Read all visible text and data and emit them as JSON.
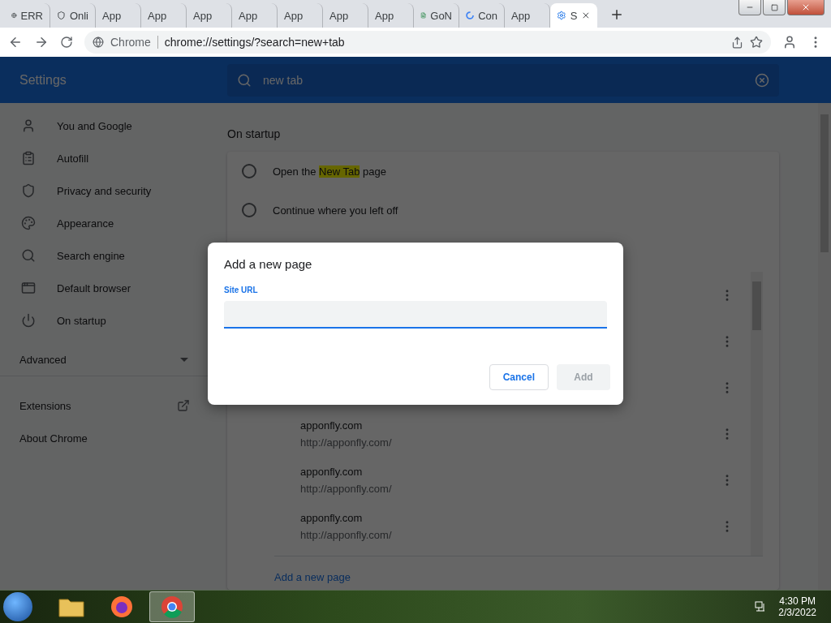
{
  "tabs": [
    {
      "label": "ERR",
      "kind": "globe",
      "selected": false
    },
    {
      "label": "Onli",
      "kind": "badge",
      "selected": false
    },
    {
      "label": "App",
      "kind": "plain",
      "selected": false
    },
    {
      "label": "App",
      "kind": "plain",
      "selected": false
    },
    {
      "label": "App",
      "kind": "plain",
      "selected": false
    },
    {
      "label": "App",
      "kind": "plain",
      "selected": false
    },
    {
      "label": "App",
      "kind": "plain",
      "selected": false
    },
    {
      "label": "App",
      "kind": "plain",
      "selected": false
    },
    {
      "label": "App",
      "kind": "plain",
      "selected": false
    },
    {
      "label": "GoN",
      "kind": "doc",
      "selected": false
    },
    {
      "label": "Con",
      "kind": "google",
      "selected": false
    },
    {
      "label": "App",
      "kind": "plain",
      "selected": false
    },
    {
      "label": "S",
      "kind": "gear",
      "selected": true
    }
  ],
  "address_bar": {
    "site_label": "Chrome",
    "url": "chrome://settings/?search=new+tab"
  },
  "settings_header": {
    "title": "Settings",
    "search": {
      "value": "new tab"
    }
  },
  "sidebar": {
    "items": [
      {
        "label": "You and Google",
        "kind": "person"
      },
      {
        "label": "Autofill",
        "kind": "clipboard"
      },
      {
        "label": "Privacy and security",
        "kind": "shield"
      },
      {
        "label": "Appearance",
        "kind": "palette"
      },
      {
        "label": "Search engine",
        "kind": "search"
      },
      {
        "label": "Default browser",
        "kind": "browser"
      },
      {
        "label": "On startup",
        "kind": "power"
      }
    ],
    "advanced": {
      "label": "Advanced",
      "expanded": false
    },
    "links": [
      {
        "label": "Extensions",
        "external": true
      },
      {
        "label": "About Chrome",
        "external": false
      }
    ]
  },
  "on_startup": {
    "heading": "On startup",
    "options": [
      {
        "before": "Open the ",
        "highlight": "New Tab",
        "after": " page",
        "selected": false
      },
      {
        "before": "Continue where you left off",
        "selected": false
      }
    ],
    "pages": [
      {
        "kind": "covered"
      },
      {
        "kind": "covered"
      },
      {
        "kind": "covered"
      },
      {
        "kind": "page",
        "name": "apponfly.com",
        "url": "http://apponfly.com/"
      },
      {
        "kind": "page",
        "name": "apponfly.com",
        "url": "http://apponfly.com/"
      },
      {
        "kind": "page",
        "name": "apponfly.com",
        "url": "http://apponfly.com/"
      }
    ],
    "add_link": "Add a new page"
  },
  "dialog": {
    "title": "Add a new page",
    "field_label": "Site URL",
    "buttons": [
      {
        "label": "Cancel",
        "disabled": false
      },
      {
        "label": "Add",
        "disabled": true
      }
    ]
  },
  "taskbar": {
    "apps": [
      {
        "kind": "folder",
        "selected": false
      },
      {
        "kind": "firefox",
        "selected": false
      },
      {
        "kind": "chrome",
        "selected": true
      }
    ],
    "time": "4:30 PM",
    "date": "2/3/2022"
  }
}
